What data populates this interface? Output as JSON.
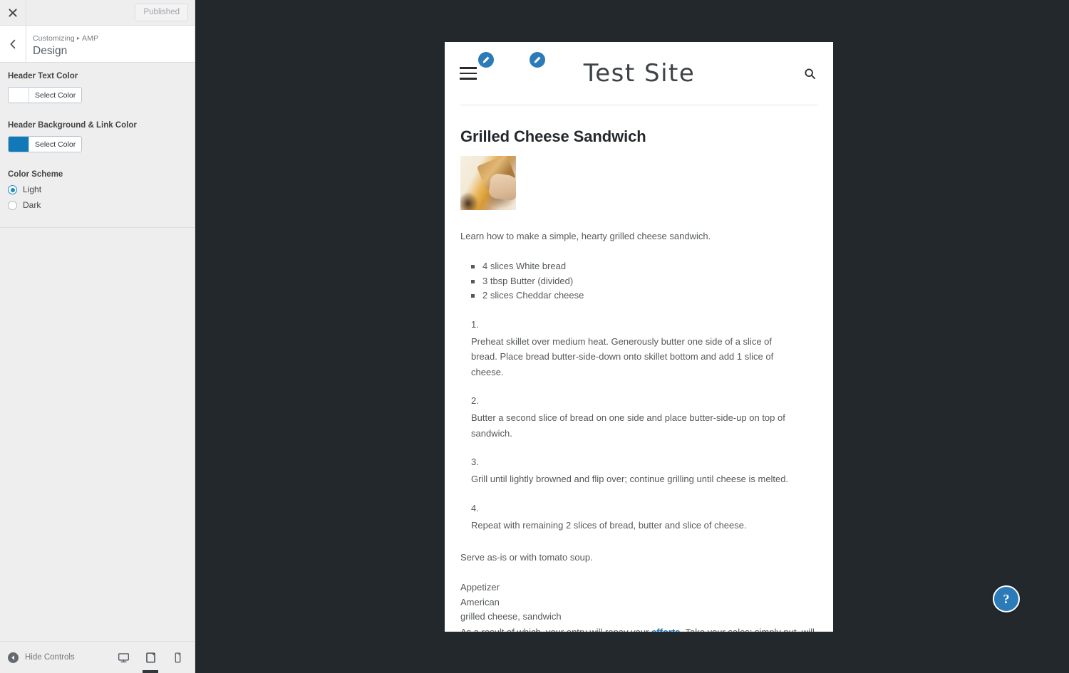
{
  "customizer": {
    "close_label": "Close",
    "publish_button": "Published",
    "back_label": "Back",
    "breadcrumb": {
      "root": "Customizing",
      "section": "AMP",
      "separator": "▸"
    },
    "panel_title": "Design",
    "controls": [
      {
        "id": "header-text-color",
        "label": "Header Text Color",
        "button_label": "Select Color",
        "swatch_color": "#ffffff"
      },
      {
        "id": "header-background-link-color",
        "label": "Header Background & Link Color",
        "button_label": "Select Color",
        "swatch_color": "#1279b8"
      }
    ],
    "color_scheme": {
      "label": "Color Scheme",
      "selected": "Light",
      "options": [
        {
          "value": "light",
          "label": "Light",
          "checked": true
        },
        {
          "value": "dark",
          "label": "Dark",
          "checked": false
        }
      ]
    },
    "footer": {
      "hide_controls_label": "Hide Controls",
      "devices": [
        {
          "id": "desktop",
          "label": "Desktop",
          "active": false
        },
        {
          "id": "tablet",
          "label": "Tablet",
          "active": true
        },
        {
          "id": "mobile",
          "label": "Mobile",
          "active": false
        }
      ]
    },
    "accent_color": "#1e8cbe"
  },
  "preview": {
    "site": {
      "title": "Test Site",
      "menu_label": "Menu",
      "search_label": "Search",
      "edit_badge_color": "#2b7bb9"
    },
    "post": {
      "title": "Grilled Cheese Sandwich",
      "featured_image_alt": "Grilled cheese sandwich being pulled apart with melted cheese",
      "description": "Learn how to make a simple, hearty grilled cheese sandwich.",
      "ingredients": [
        "4 slices White bread",
        "3 tbsp Butter (divided)",
        "2 slices Cheddar cheese"
      ],
      "steps": [
        {
          "number": "1.",
          "text": "Preheat skillet over medium heat. Generously butter one side of a slice of bread. Place bread butter-side-down onto skillet bottom and add 1 slice of cheese."
        },
        {
          "number": "2.",
          "text": "Butter a second slice of bread on one side and place butter-side-up on top of sandwich."
        },
        {
          "number": "3.",
          "text": "Grill until lightly browned and flip over; continue grilling until cheese is melted."
        },
        {
          "number": "4.",
          "text": "Repeat with remaining 2 slices of bread, butter and slice of cheese."
        }
      ],
      "closing_note": "Serve as-is or with tomato soup.",
      "meta": [
        "Appetizer",
        "American",
        "grilled cheese, sandwich"
      ],
      "body_paragraph": {
        "before_link": "As a result of which, your entry will repay your ",
        "link_text": "efforts",
        "after_link": ". Take your sales; simply put, will rise. Likewise your credibility. There’s every chance your competitors will wish they’d placed this entry, not you. While your customers will have probably forgotten",
        "link_color": "#1a72b8"
      }
    },
    "help_button": {
      "label": "?",
      "title": "Help",
      "color": "#2b7bb9"
    },
    "background_color": "#23282d"
  }
}
